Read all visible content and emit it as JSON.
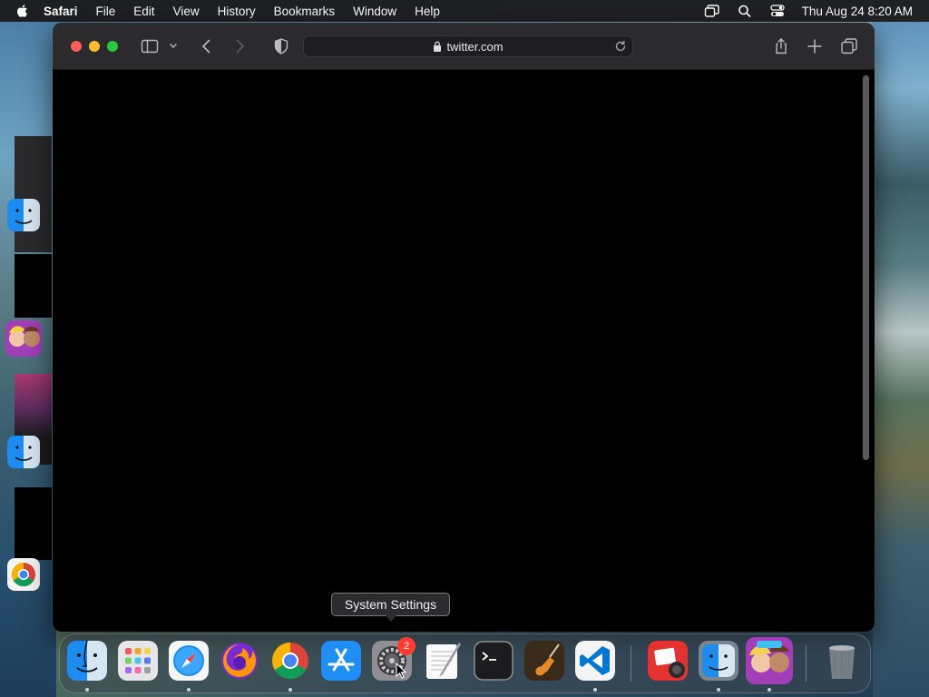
{
  "menubar": {
    "app_name": "Safari",
    "menus": [
      "File",
      "Edit",
      "View",
      "History",
      "Bookmarks",
      "Window",
      "Help"
    ],
    "clock": "Thu Aug 24  8:20 AM"
  },
  "safari": {
    "address": "twitter.com"
  },
  "tooltip": {
    "text": "System Settings"
  },
  "dock": {
    "items": [
      "finder-icon",
      "launchpad-icon",
      "safari-icon",
      "firefox-icon",
      "chrome-icon",
      "app-store-icon",
      "system-settings-icon",
      "textedit-icon",
      "terminal-icon",
      "garageband-icon",
      "vscode-icon",
      "photo-booth-icon",
      "finder-icon",
      "game-icon",
      "trash-icon"
    ],
    "settings_badge": "2"
  },
  "colors": {
    "close": "#ff5f57",
    "minimize": "#febc2e",
    "zoom": "#28c840",
    "badge": "#ff3b30"
  }
}
